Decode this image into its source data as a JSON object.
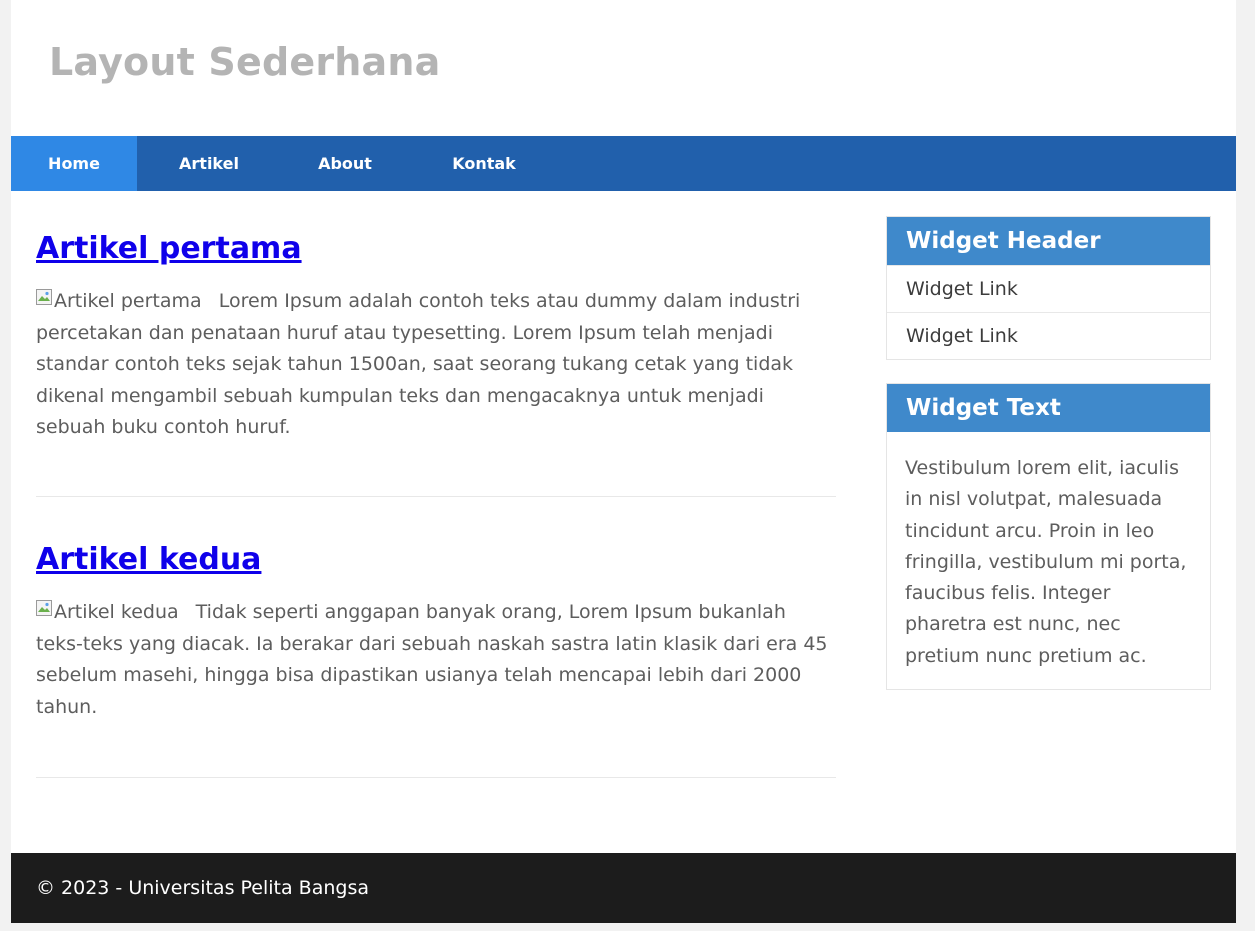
{
  "header": {
    "title": "Layout Sederhana"
  },
  "nav": {
    "items": [
      {
        "label": "Home",
        "active": true
      },
      {
        "label": "Artikel",
        "active": false
      },
      {
        "label": "About",
        "active": false
      },
      {
        "label": "Kontak",
        "active": false
      }
    ]
  },
  "articles": [
    {
      "title": "Artikel pertama",
      "image_alt": "Artikel pertama",
      "body": "Lorem Ipsum adalah contoh teks atau dummy dalam industri percetakan dan penataan huruf atau typesetting. Lorem Ipsum telah menjadi standar contoh teks sejak tahun 1500an, saat seorang tukang cetak yang tidak dikenal mengambil sebuah kumpulan teks dan mengacaknya untuk menjadi sebuah buku contoh huruf."
    },
    {
      "title": "Artikel kedua",
      "image_alt": "Artikel kedua",
      "body": "Tidak seperti anggapan banyak orang, Lorem Ipsum bukanlah teks-teks yang diacak. Ia berakar dari sebuah naskah sastra latin klasik dari era 45 sebelum masehi, hingga bisa dipastikan usianya telah mencapai lebih dari 2000 tahun."
    }
  ],
  "sidebar": {
    "widget_links": {
      "header": "Widget Header",
      "links": [
        "Widget Link",
        "Widget Link"
      ]
    },
    "widget_text": {
      "header": "Widget Text",
      "body": "Vestibulum lorem elit, iaculis in nisl volutpat, malesuada tincidunt arcu. Proin in leo fringilla, vestibulum mi porta, faucibus felis. Integer pharetra est nunc, nec pretium nunc pretium ac."
    }
  },
  "footer": {
    "text": "© 2023 - Universitas Pelita Bangsa"
  },
  "colors": {
    "nav_bg": "#2160ac",
    "nav_active": "#2f88e5",
    "widget_header": "#3f89cb",
    "footer_bg": "#1c1c1c",
    "link": "#0f00ea"
  }
}
